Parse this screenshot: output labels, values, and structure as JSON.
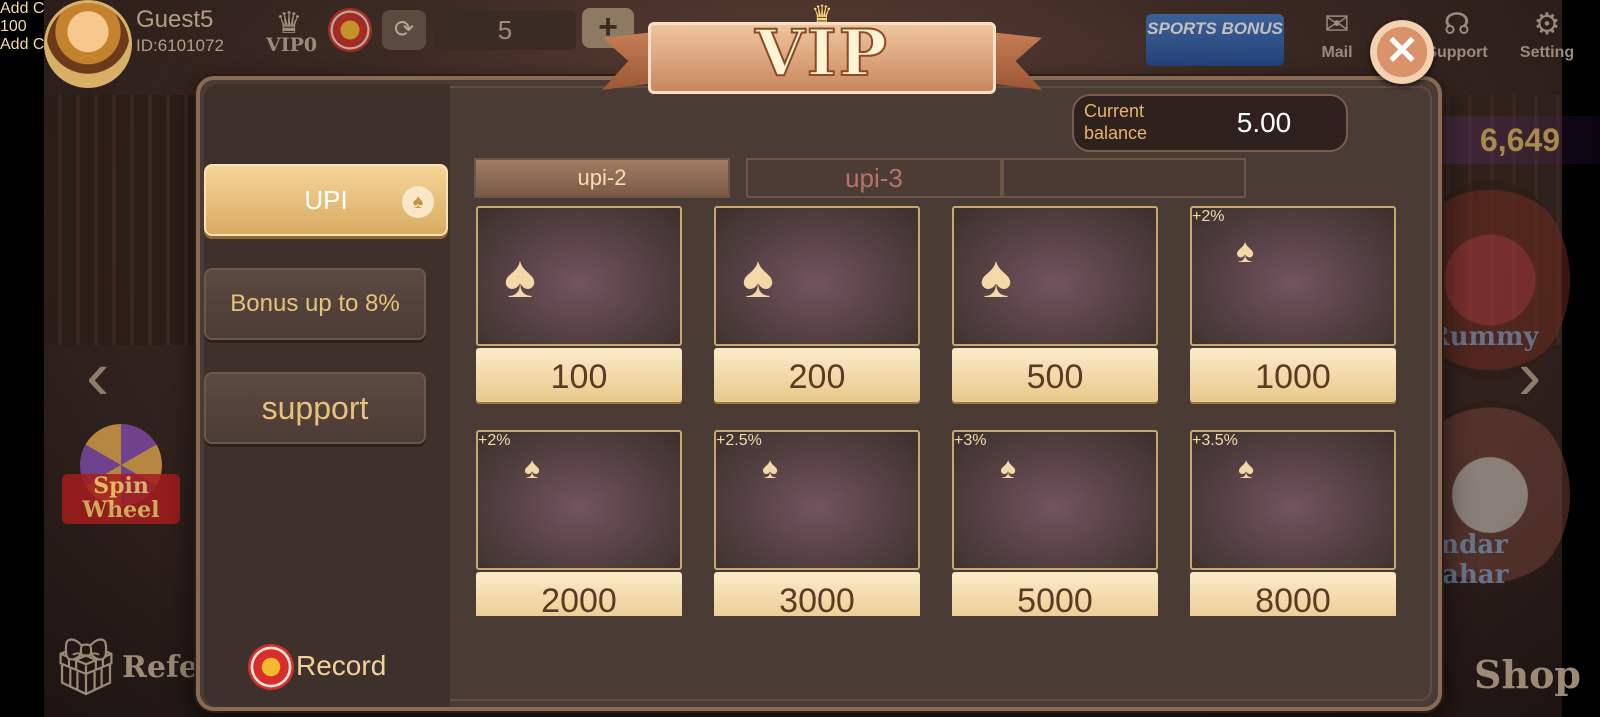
{
  "topbar": {
    "guest_name": "Guest5",
    "guest_id": "ID:6101072",
    "vip_level": "VIP0",
    "chip_balance": "5",
    "sports_bonus": "SPORTS BONUS",
    "mail_label": "Mail",
    "support_label": "Support",
    "setting_label": "Setting"
  },
  "lobby": {
    "right_balance": "6,649",
    "rummy_label": "Rummy",
    "andar_label": "Andar Bahar",
    "spin_wheel_label": "Spin Wheel",
    "refer_label": "Refer",
    "shop_label": "Shop"
  },
  "modal": {
    "title": "VIP",
    "current_balance_label": "Current balance",
    "current_balance_value": "5.00",
    "sidebar": [
      {
        "label": "UPI",
        "active": true
      },
      {
        "label": "Bonus up to 8%",
        "active": false
      },
      {
        "label": "support",
        "active": false
      }
    ],
    "record_label": "Record",
    "tabs": [
      {
        "label": "upi-2",
        "active": true
      },
      {
        "label": "upi-3",
        "active": false
      },
      {
        "label": "",
        "active": false
      }
    ],
    "packages": [
      {
        "amount": "100",
        "bonus": ""
      },
      {
        "amount": "200",
        "bonus": ""
      },
      {
        "amount": "500",
        "bonus": ""
      },
      {
        "amount": "1000",
        "bonus": "+2%"
      },
      {
        "amount": "2000",
        "bonus": "+2%"
      },
      {
        "amount": "3000",
        "bonus": "+2.5%"
      },
      {
        "amount": "5000",
        "bonus": "+3%"
      },
      {
        "amount": "8000",
        "bonus": "+3.5%"
      }
    ],
    "add_chips_label": "Add Chips",
    "amount_value": "100",
    "add_chips_button": "Add Chips"
  },
  "colors": {
    "accent_gold": "#e8c98d",
    "button_orange": "#f4a419",
    "chip_red": "#d92d29"
  }
}
